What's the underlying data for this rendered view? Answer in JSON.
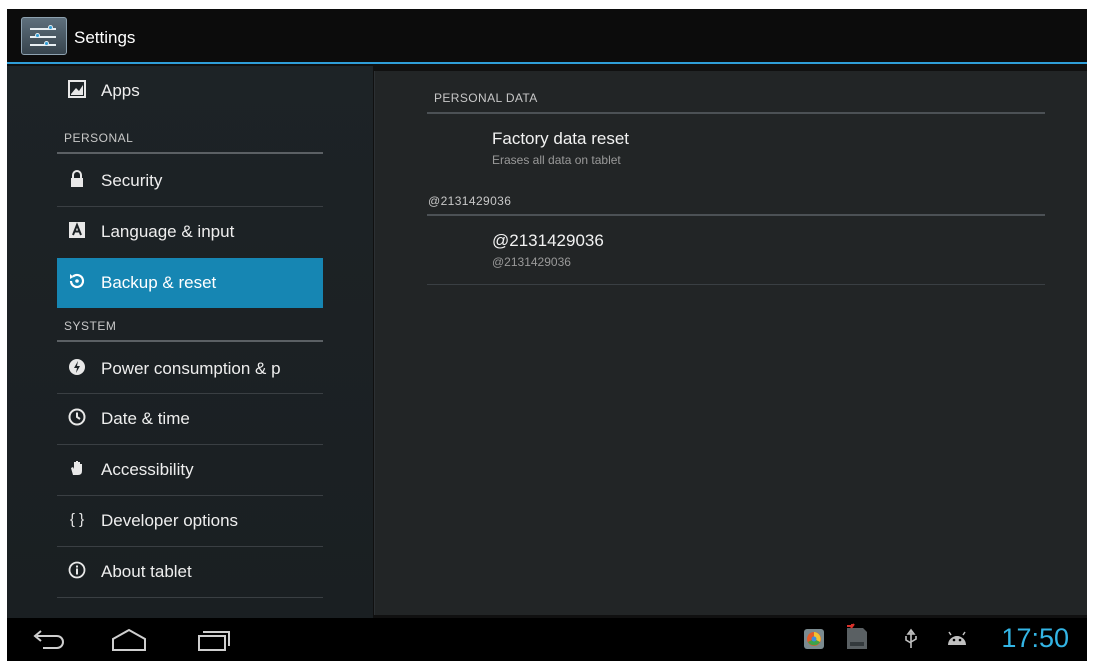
{
  "app": {
    "title": "Settings",
    "icon": "settings-icon"
  },
  "sidebar": {
    "items": [
      {
        "label": "Apps",
        "icon": "apps-icon"
      },
      {
        "label": "Security",
        "icon": "lock-icon"
      },
      {
        "label": "Language & input",
        "icon": "keyboard-icon"
      },
      {
        "label": "Backup & reset",
        "icon": "backup-icon",
        "selected": true
      },
      {
        "label": "Power consumption & p",
        "icon": "power-icon"
      },
      {
        "label": "Date & time",
        "icon": "clock-icon"
      },
      {
        "label": "Accessibility",
        "icon": "hand-icon"
      },
      {
        "label": "Developer options",
        "icon": "braces-icon"
      },
      {
        "label": "About tablet",
        "icon": "info-icon"
      }
    ],
    "headers": {
      "personal": "PERSONAL",
      "system": "SYSTEM"
    }
  },
  "detail": {
    "section1": {
      "header": "PERSONAL DATA",
      "item": {
        "title": "Factory data reset",
        "summary": "Erases all data on tablet"
      }
    },
    "section2": {
      "header": "@2131429036",
      "item": {
        "title": "@2131429036",
        "summary": "@2131429036"
      }
    }
  },
  "navbar": {
    "buttons": [
      "back-icon",
      "home-icon",
      "recents-icon"
    ],
    "status_icons": [
      "app-notification-icon",
      "sd-card-icon",
      "usb-icon",
      "android-debug-icon"
    ],
    "clock": "17:50"
  },
  "colors": {
    "accent": "#33b5e5",
    "selected": "#1686b3",
    "action_bar_rule": "#2f9ed8"
  }
}
